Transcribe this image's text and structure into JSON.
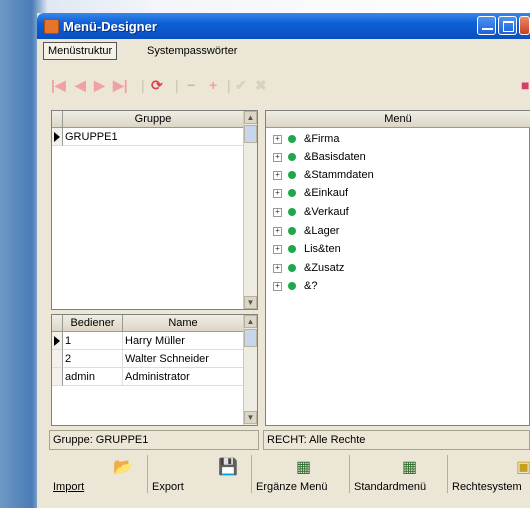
{
  "window": {
    "title": "Menü-Designer"
  },
  "tabs": [
    {
      "label": "Menüstruktur"
    },
    {
      "label": "Systempasswörter"
    }
  ],
  "gruppe_table": {
    "header": "Gruppe",
    "rows": [
      "GRUPPE1"
    ]
  },
  "bediener_table": {
    "headers": [
      "Bediener",
      "Name"
    ],
    "rows": [
      {
        "id": "1",
        "name": "Harry Müller"
      },
      {
        "id": "2",
        "name": "Walter Schneider"
      },
      {
        "id": "admin",
        "name": "Administrator"
      }
    ]
  },
  "menu_tree": {
    "header": "Menü",
    "items": [
      "&Firma",
      "&Basisdaten",
      "&Stammdaten",
      "&Einkauf",
      "&Verkauf",
      "&Lager",
      "Lis&ten",
      "&Zusatz",
      "&?"
    ]
  },
  "status": {
    "left": "Gruppe: GRUPPE1",
    "right": "RECHT: Alle Rechte"
  },
  "buttons": {
    "import": "Import",
    "export": "Export",
    "ergaenze": "Ergänze Menü",
    "standard": "Standardmenü",
    "rechte": "Rechtesystem"
  }
}
